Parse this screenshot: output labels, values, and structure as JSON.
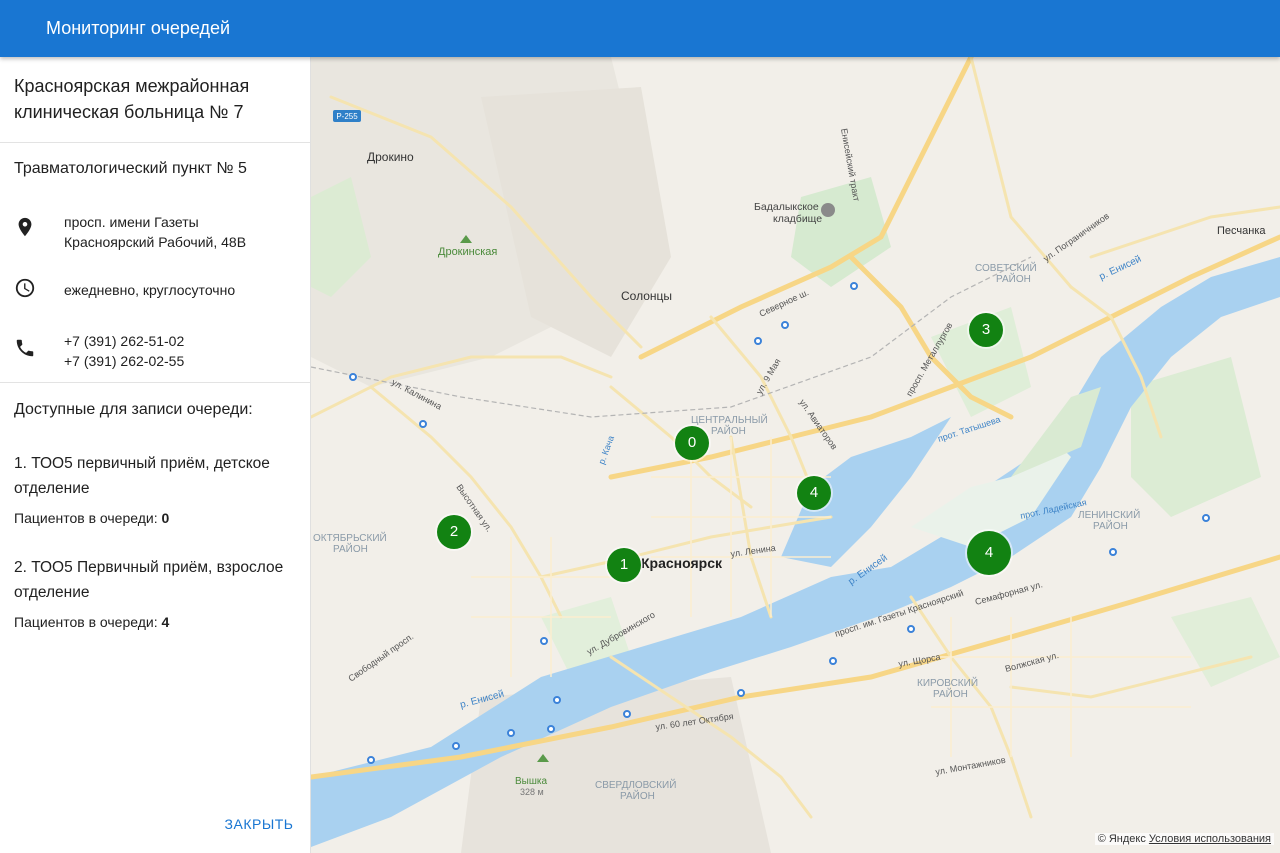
{
  "app": {
    "title": "Мониторинг очередей"
  },
  "hospital": {
    "name": "Красноярская межрайонная клиническая больница № 7"
  },
  "point": {
    "name": "Травматологический пункт № 5",
    "address_line1": "просп. имени Газеты",
    "address_line2": "Красноярский Рабочий, 48В",
    "hours": "ежедневно, круглосуточно",
    "phone1": "+7 (391) 262-51-02",
    "phone2": "+7 (391) 262-02-55",
    "icons": {
      "address": "location-pin-icon",
      "hours": "clock-icon",
      "phone": "phone-icon"
    }
  },
  "queues": {
    "title": "Доступные для записи очереди:",
    "count_label": "Пациентов в очереди:",
    "items": [
      {
        "name": "1. ТОО5 первичный приём, детское отделение",
        "count": "0"
      },
      {
        "name": "2. ТОО5 Первичный приём, взрослое отделение",
        "count": "4"
      }
    ]
  },
  "actions": {
    "close_label": "ЗАКРЫТЬ"
  },
  "map": {
    "markers": [
      {
        "label": "0"
      },
      {
        "label": "3"
      },
      {
        "label": "4"
      },
      {
        "label": "2"
      },
      {
        "label": "1"
      },
      {
        "label": "4"
      }
    ],
    "labels": {
      "drokino": "Дрокино",
      "drokinskaya": "Дрокинская",
      "solontsy": "Солонцы",
      "badalyk1": "Бадалыкское",
      "badalyk2": "кладбище",
      "peschanka": "Песчанка",
      "sovetsky1": "СОВЕТСКИЙ",
      "sovetsky2": "РАЙОН",
      "central1": "ЦЕНТРАЛЬНЫЙ",
      "central2": "РАЙОН",
      "oktyabrsky1": "ОКТЯБРЬСКИЙ",
      "oktyabrsky2": "РАЙОН",
      "leninsky1": "ЛЕНИНСКИЙ",
      "leninsky2": "РАЙОН",
      "kirovsky1": "КИРОВСКИЙ",
      "kirovsky2": "РАЙОН",
      "sverdlovsky1": "СВЕРДЛОВСКИЙ",
      "sverdlovsky2": "РАЙОН",
      "krasnoyarsk": "Красноярск",
      "vyshka": "Вышка",
      "vyshka_alt": "328 м",
      "r255": "Р-255",
      "enisey1": "р. Енисей",
      "enisey2": "р. Енисей",
      "enisey3": "р. Енисей",
      "kalinina": "ул. Калинина",
      "severnoe": "Северное ш.",
      "metallurgov": "просп. Металлургов",
      "gazety": "просп. им. Газеты Красноярский",
      "semafornaya": "Семафорная ул.",
      "lenina": "ул. Ленина",
      "oktyabrya": "ул. 60 лет Октября",
      "volzhskaya": "Волжская ул.",
      "montazhnikov": "ул. Монтажников",
      "pogranichnikov": "ул. Пограничников",
      "enisey_trakt": "Енисейский тракт",
      "shors": "ул. Щорса",
      "tatysheva": "прот. Татышева",
      "ladeyskaya": "прот. Ладейская",
      "vysotnaya": "Высотная ул.",
      "aviatorov": "ул. Авиаторов",
      "maya9": "ул. 9 Мая",
      "dubrovinskogo": "ул. Дубровинского",
      "svobodny": "Свободный просп.",
      "kacha": "р. Кача"
    },
    "copyright": "© Яндекс",
    "terms": "Условия использования"
  }
}
